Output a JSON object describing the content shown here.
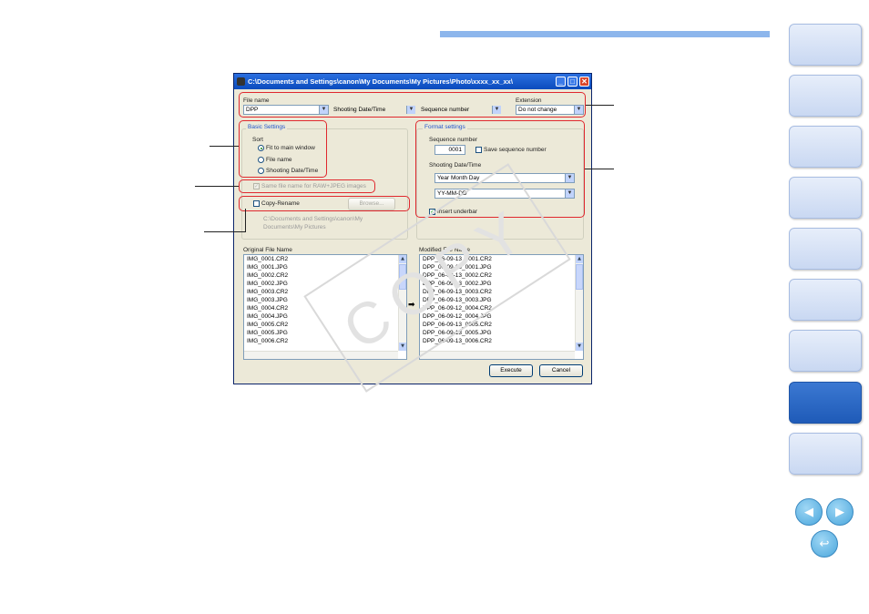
{
  "window": {
    "title": "C:\\Documents and Settings\\canon\\My Documents\\My Pictures\\Photo\\xxxx_xx_xx\\"
  },
  "file_name": {
    "label": "File name",
    "field1": "DPP",
    "field2": "Shooting Date/Time",
    "field3": "Sequence number",
    "extension_label": "Extension",
    "extension_value": "Do not change"
  },
  "basic_settings": {
    "title": "Basic Settings",
    "sort_label": "Sort",
    "sort_options": [
      "Fit to main window",
      "File name",
      "Shooting Date/Time"
    ],
    "same_name_label": "Same file name for RAW+JPEG images",
    "copy_rename_label": "Copy-Rename",
    "browse_label": "Browse...",
    "path_line1": "C:\\Documents and Settings\\canon\\My",
    "path_line2": "Documents\\My Pictures"
  },
  "format_settings": {
    "title": "Format settings",
    "sequence_label": "Sequence number",
    "sequence_value": "0001",
    "save_sequence_label": "Save sequence number",
    "shooting_label": "Shooting Date/Time",
    "order_value": "Year Month Day",
    "format_value": "YY-MM-DD",
    "insert_underbar_label": "Insert underbar"
  },
  "original_list": {
    "label": "Original File Name",
    "items": [
      "IMG_0001.CR2",
      "IMG_0001.JPG",
      "IMG_0002.CR2",
      "IMG_0002.JPG",
      "IMG_0003.CR2",
      "IMG_0003.JPG",
      "IMG_0004.CR2",
      "IMG_0004.JPG",
      "IMG_0005.CR2",
      "IMG_0005.JPG",
      "IMG_0006.CR2"
    ]
  },
  "modified_list": {
    "label": "Modified File Name",
    "items": [
      "DPP_06-09-13_0001.CR2",
      "DPP_06-09-13_0001.JPG",
      "DPP_06-09-13_0002.CR2",
      "DPP_06-09-13_0002.JPG",
      "DPP_06-09-13_0003.CR2",
      "DPP_06-09-13_0003.JPG",
      "DPP_06-09-12_0004.CR2",
      "DPP_06-09-12_0004.JPG",
      "DPP_06-09-13_0005.CR2",
      "DPP_06-09-13_0005.JPG",
      "DPP_06-09-13_0006.CR2"
    ]
  },
  "buttons": {
    "execute": "Execute",
    "cancel": "Cancel"
  },
  "watermark": "COPY",
  "colors": {
    "accent_bar": "#8db6ec",
    "active_tab": "#2a6cc8",
    "highlight": "#e0282e"
  }
}
